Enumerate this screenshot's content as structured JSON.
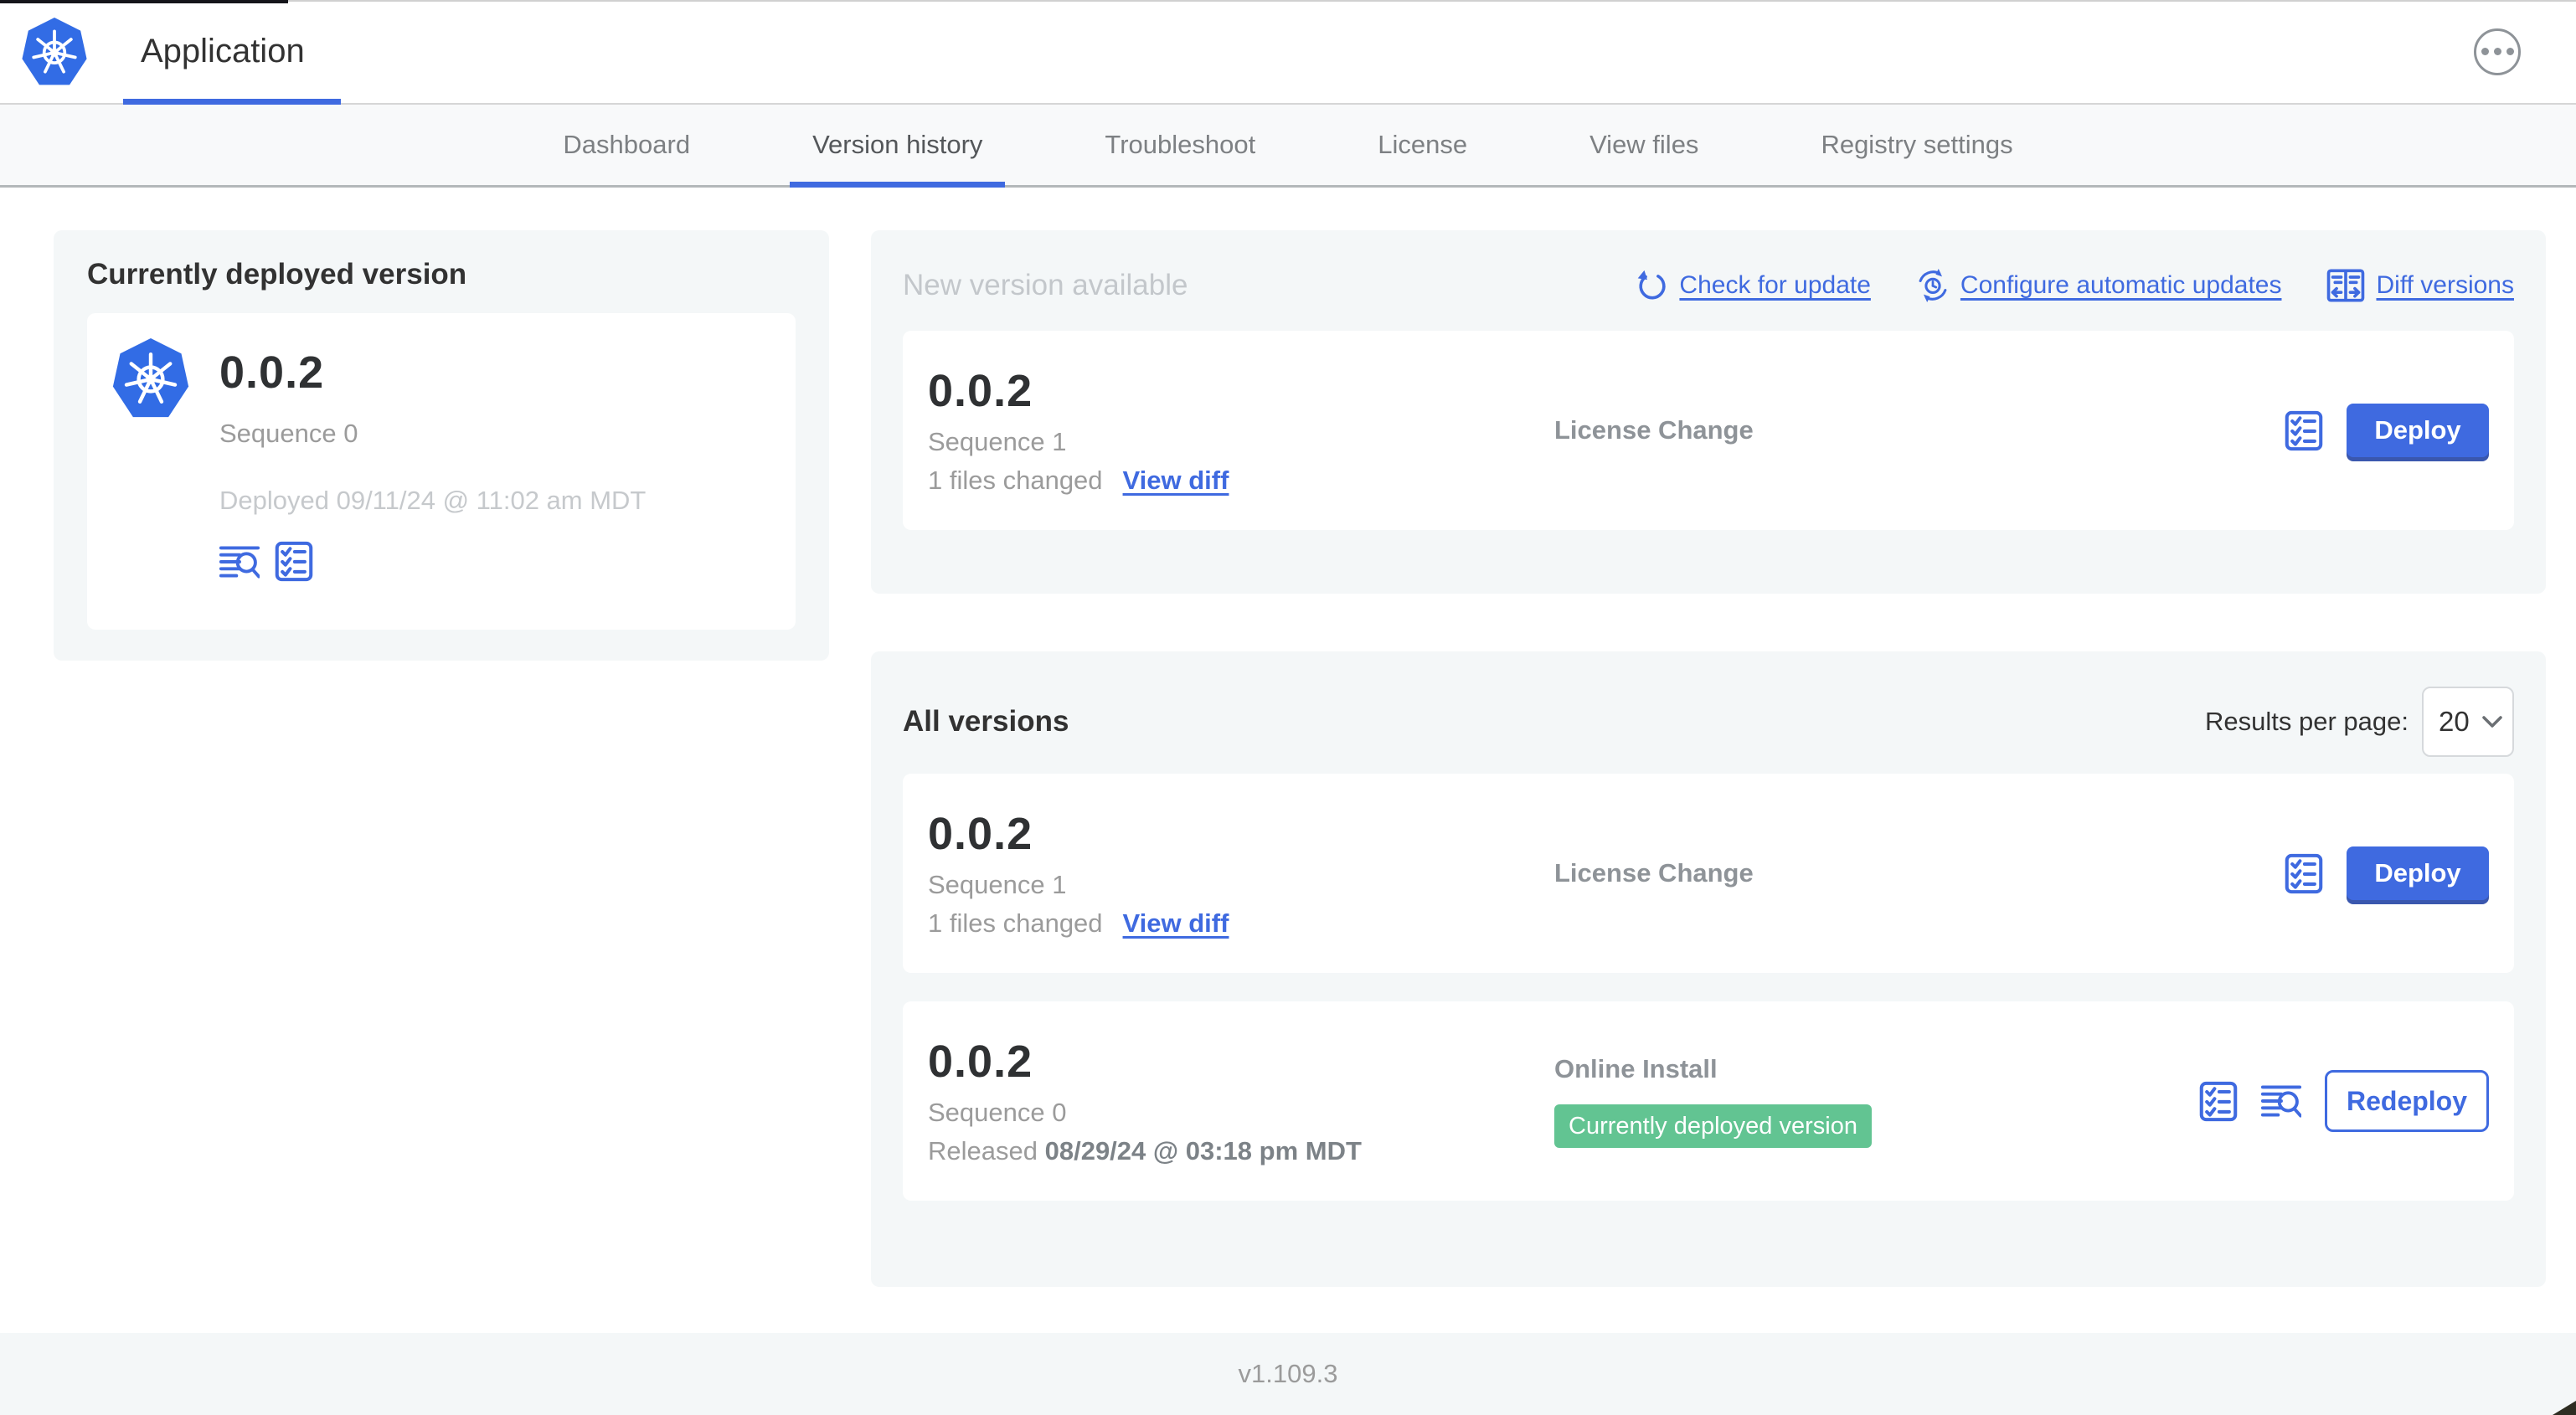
{
  "header": {
    "app_title": "Application"
  },
  "tabs": {
    "items": [
      "Dashboard",
      "Version history",
      "Troubleshoot",
      "License",
      "View files",
      "Registry settings"
    ],
    "active": "Version history"
  },
  "current_version_panel": {
    "title": "Currently deployed version",
    "version": "0.0.2",
    "sequence_label": "Sequence 0",
    "deployed_label": "Deployed 09/11/24 @ 11:02 am MDT"
  },
  "new_version_panel": {
    "title": "New version available",
    "check_for_update_label": "Check for update",
    "configure_updates_label": "Configure automatic updates",
    "diff_versions_label": "Diff versions",
    "card": {
      "version": "0.0.2",
      "sequence_label": "Sequence 1",
      "files_changed_label": "1 files changed",
      "view_diff_label": "View diff",
      "source_label": "License Change",
      "action_label": "Deploy"
    }
  },
  "all_versions_panel": {
    "title": "All versions",
    "results_per_page_label": "Results per page:",
    "results_per_page_value": "20",
    "cards": [
      {
        "version": "0.0.2",
        "sequence_label": "Sequence 1",
        "files_changed_label": "1 files changed",
        "view_diff_label": "View diff",
        "source_label": "License Change",
        "action_label": "Deploy"
      },
      {
        "version": "0.0.2",
        "sequence_label": "Sequence 0",
        "released_prefix": "Released",
        "released_date": "08/29/24 @ 03:18 pm MDT",
        "source_label": "Online Install",
        "badge_label": "Currently deployed version",
        "action_label": "Redeploy"
      }
    ]
  },
  "footer": {
    "app_version": "v1.109.3"
  },
  "colors": {
    "accent_blue": "#3f6ae0",
    "kubernetes_blue": "#326ce5",
    "badge_green": "#62c492",
    "panel_gray": "#f4f7f8",
    "text_dark": "#323232",
    "text_gray": "#9b9b9b",
    "text_light_gray": "#c3c7cb"
  }
}
